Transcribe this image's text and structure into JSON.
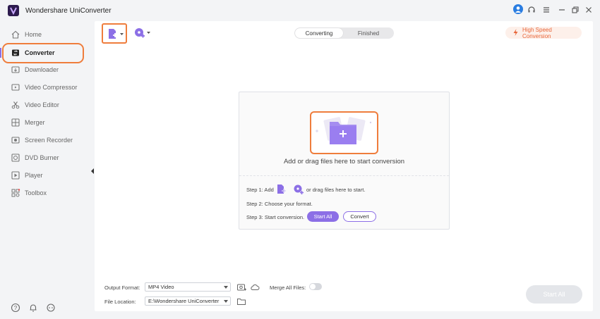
{
  "app": {
    "title": "Wondershare UniConverter"
  },
  "sidebar": {
    "items": [
      {
        "label": "Home",
        "icon": "home-icon"
      },
      {
        "label": "Converter",
        "icon": "converter-icon",
        "active": true
      },
      {
        "label": "Downloader",
        "icon": "download-icon"
      },
      {
        "label": "Video Compressor",
        "icon": "compress-icon"
      },
      {
        "label": "Video Editor",
        "icon": "scissors-icon"
      },
      {
        "label": "Merger",
        "icon": "merge-icon"
      },
      {
        "label": "Screen Recorder",
        "icon": "record-icon"
      },
      {
        "label": "DVD Burner",
        "icon": "disc-icon"
      },
      {
        "label": "Player",
        "icon": "play-icon"
      },
      {
        "label": "Toolbox",
        "icon": "grid-icon"
      }
    ]
  },
  "tabs": {
    "converting": "Converting",
    "finished": "Finished"
  },
  "toolbar": {
    "high_speed": "High Speed Conversion"
  },
  "dropzone": {
    "main_text": "Add or drag files here to start conversion",
    "step1_prefix": "Step 1: Add",
    "step1_suffix": "or drag files here to start.",
    "step2": "Step 2: Choose your format.",
    "step3": "Step 3: Start conversion.",
    "start_all": "Start All",
    "convert": "Convert"
  },
  "bottom": {
    "output_format_label": "Output Format:",
    "output_format_value": "MP4 Video",
    "merge_label": "Merge All Files:",
    "file_location_label": "File Location:",
    "file_location_value": "E:\\Wondershare UniConverter",
    "start_all": "Start All"
  },
  "colors": {
    "accent": "#8c6fe6",
    "highlight": "#ef7d3c",
    "high_speed": "#e8663a"
  }
}
